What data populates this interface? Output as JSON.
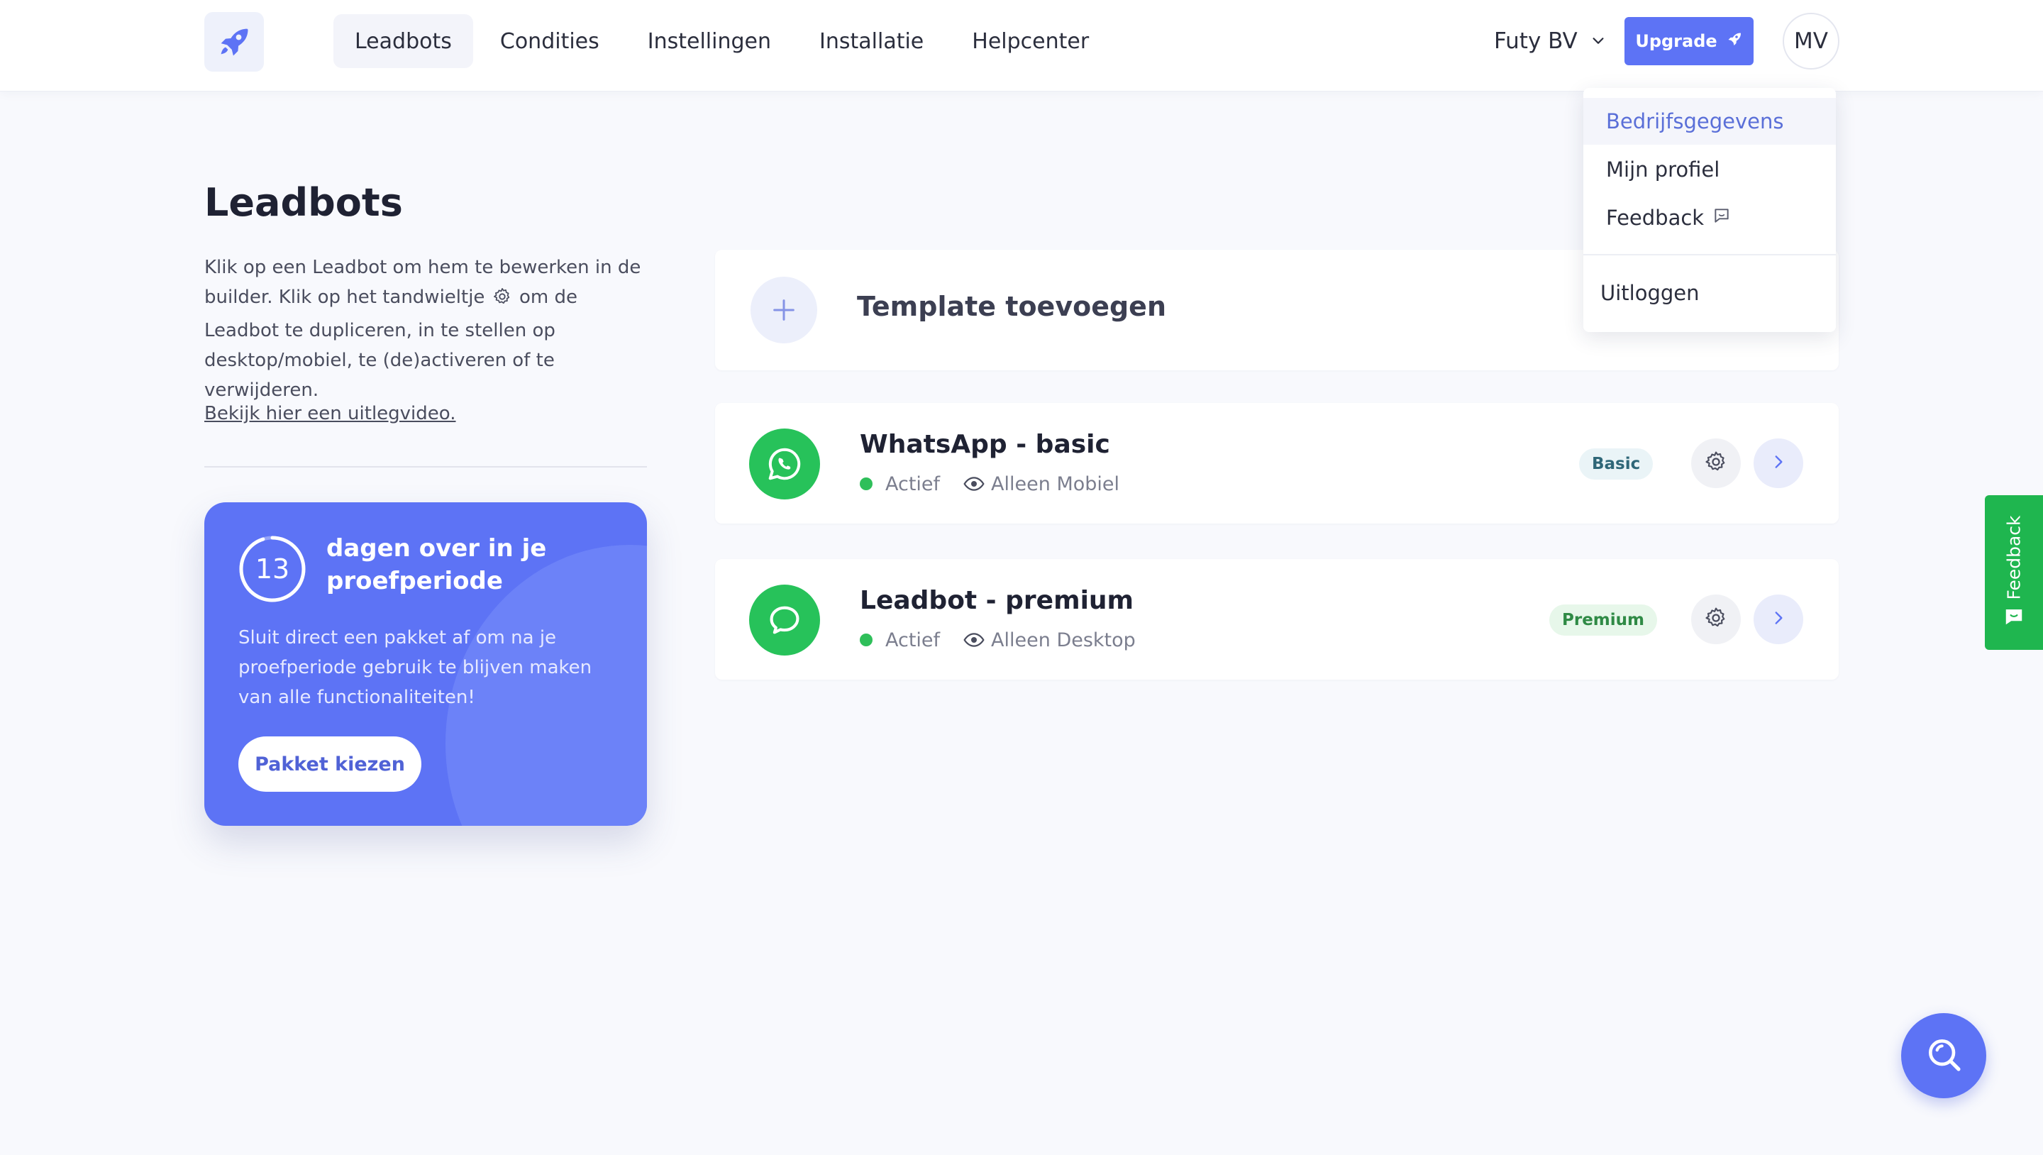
{
  "nav": {
    "items": [
      {
        "label": "Leadbots",
        "active": true
      },
      {
        "label": "Condities",
        "active": false
      },
      {
        "label": "Instellingen",
        "active": false
      },
      {
        "label": "Installatie",
        "active": false
      },
      {
        "label": "Helpcenter",
        "active": false
      }
    ],
    "company": "Futy BV",
    "upgrade_label": "Upgrade",
    "avatar_initials": "MV"
  },
  "dropdown": {
    "items": [
      "Bedrijfsgegevens",
      "Mijn profiel",
      "Feedback"
    ],
    "logout": "Uitloggen"
  },
  "intro": {
    "title": "Leadbots",
    "text_before_icon": "Klik op een Leadbot om hem te bewerken in de builder. Klik op het tandwieltje",
    "text_after_icon": "om de Leadbot te dupliceren, in te stellen op desktop/mobiel, te (de)activeren of te verwijderen.",
    "video_link": "Bekijk hier een uitlegvideo."
  },
  "trial": {
    "days": "13",
    "days_fraction": 0.95,
    "heading": "dagen over in je proefperiode",
    "text": "Sluit direct een pakket af om na je proefperiode gebruik te blijven maken van alle functionaliteiten!",
    "button": "Pakket kiezen"
  },
  "add_template": {
    "label": "Template toevoegen"
  },
  "leadbots": [
    {
      "name": "WhatsApp - basic",
      "status": "Actief",
      "visibility": "Alleen Mobiel",
      "badge": "Basic"
    },
    {
      "name": "Leadbot - premium",
      "status": "Actief",
      "visibility": "Alleen Desktop",
      "badge": "Premium"
    }
  ],
  "feedback_tab": {
    "label": "Feedback"
  },
  "colors": {
    "accent": "#5d73f5",
    "whatsapp_green": "#27c25a",
    "feedback_green": "#1fb64f"
  }
}
